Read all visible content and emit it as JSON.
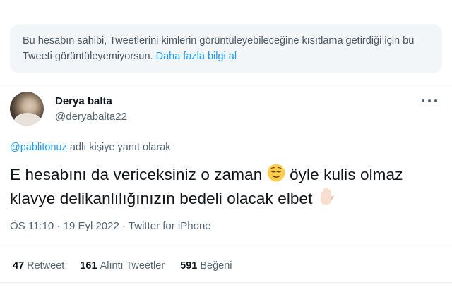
{
  "notice": {
    "text": "Bu hesabın sahibi, Tweetlerini kimlerin görüntüleyebileceğine kısıtlama getirdiği için bu Tweeti görüntüleyemiyorsun.",
    "link": "Daha fazla bilgi al"
  },
  "author": {
    "name": "Derya balta",
    "handle": "@deryabalta22"
  },
  "reply": {
    "mention": "@pablitonuz",
    "text": "adlı kişiye yanıt olarak"
  },
  "tweet": {
    "line1_a": "E hesabını da vericeksiniz o zaman",
    "line1_b": "öyle kulis olmaz",
    "line2": "klavye delikanlılığınızın  bedeli olacak elbet",
    "emoji1": "relieved-face-icon",
    "emoji2": "raised-hand-icon"
  },
  "meta": {
    "time": "ÖS 11:10",
    "date": "19 Eyl 2022",
    "source": "Twitter for iPhone"
  },
  "stats": {
    "retweets_count": "47",
    "retweets_label": "Retweet",
    "quotes_count": "161",
    "quotes_label": "Alıntı Tweetler",
    "likes_count": "591",
    "likes_label": "Beğeni"
  },
  "colors": {
    "accent": "#1d9bf0",
    "secondary_text": "#536471",
    "notice_bg": "#f3f6f8"
  }
}
